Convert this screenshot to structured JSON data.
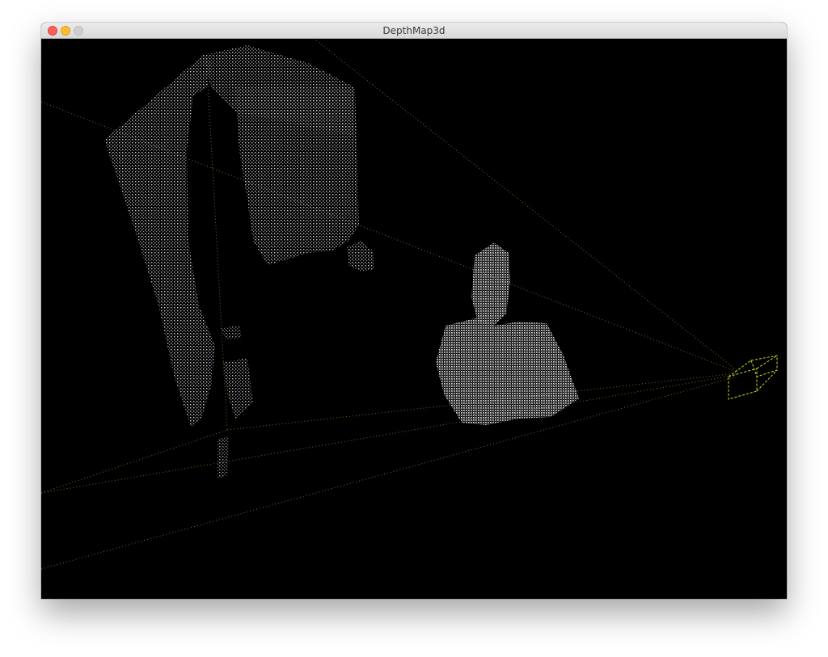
{
  "window": {
    "title": "DepthMap3d",
    "buttons": {
      "close_color": "#fe5f57",
      "minimize_color": "#febc2e",
      "zoom_color": "#cfcfcf"
    }
  },
  "scene": {
    "background": "#000000",
    "point_color": "#e8e8e8",
    "frustum_color": "#8a8a3a",
    "camera_color": "#d8d820",
    "icons": [
      "point-cloud",
      "camera-frustum",
      "camera-icon"
    ]
  }
}
